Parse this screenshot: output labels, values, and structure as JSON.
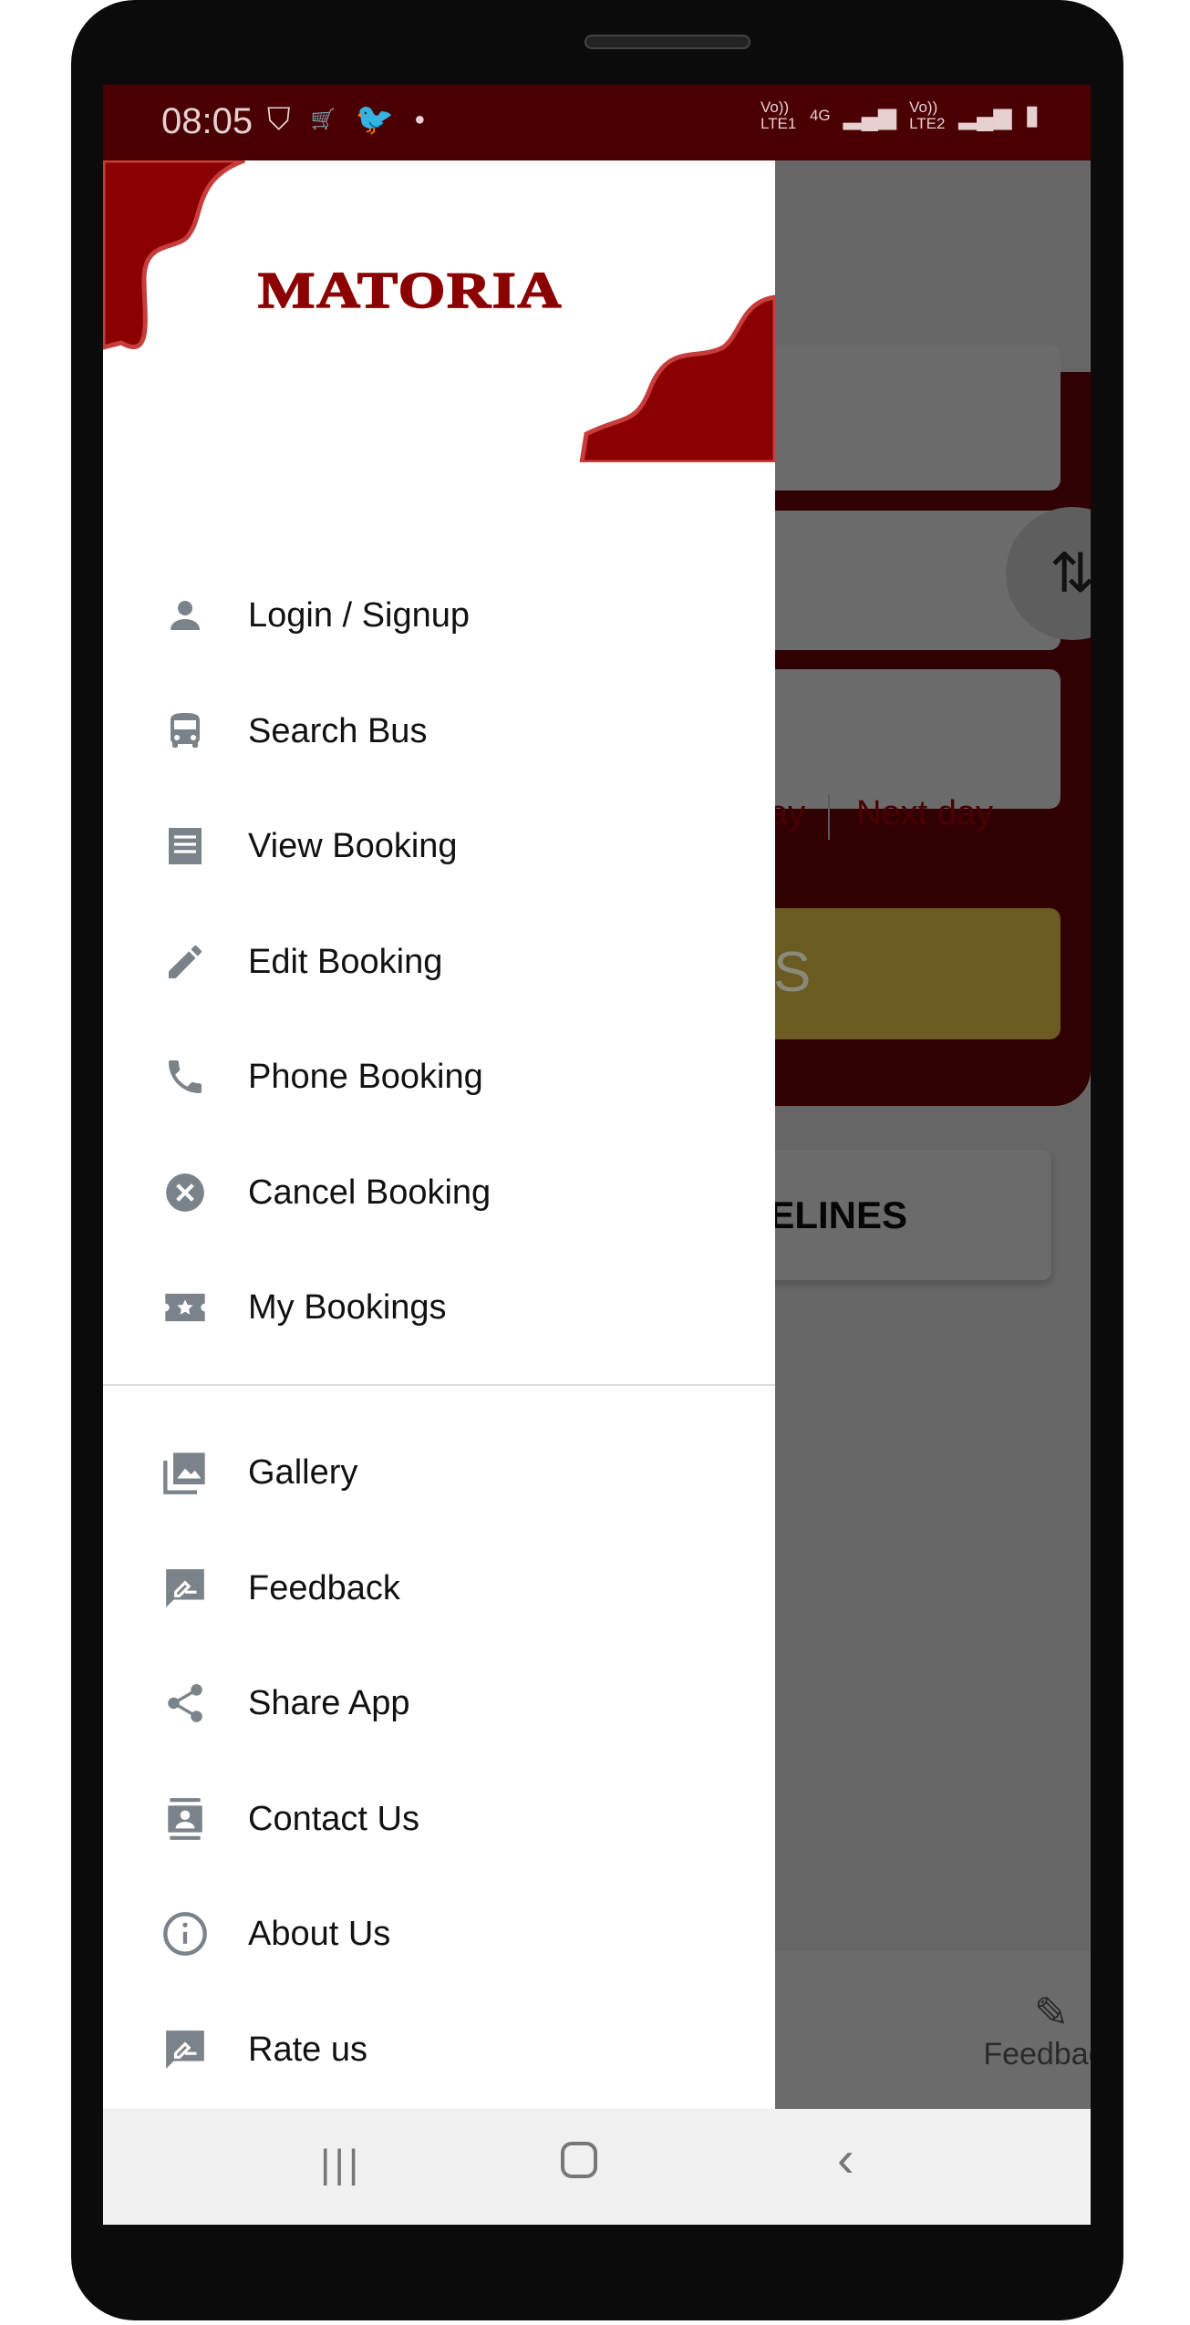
{
  "status_bar": {
    "time": "08:05",
    "left_icons": [
      "shield-check-icon",
      "amazon-cart-icon",
      "twitter-icon",
      "dot-icon"
    ],
    "sim1": "Vo)) LTE1",
    "network": "4G",
    "sim2": "Vo)) LTE2",
    "battery": "charging"
  },
  "drawer": {
    "logo": "MATORIA",
    "items": [
      {
        "label": "Login / Signup",
        "icon": "person-icon"
      },
      {
        "label": "Search Bus",
        "icon": "bus-icon"
      },
      {
        "label": "View Booking",
        "icon": "receipt-icon"
      },
      {
        "label": "Edit Booking",
        "icon": "pencil-icon"
      },
      {
        "label": "Phone Booking",
        "icon": "phone-icon"
      },
      {
        "label": "Cancel Booking",
        "icon": "cancel-icon"
      },
      {
        "label": "My Bookings",
        "icon": "ticket-star-icon"
      }
    ],
    "secondary_items": [
      {
        "label": "Gallery",
        "icon": "gallery-icon"
      },
      {
        "label": "Feedback",
        "icon": "feedback-icon"
      },
      {
        "label": "Share App",
        "icon": "share-icon"
      },
      {
        "label": "Contact Us",
        "icon": "contact-icon"
      },
      {
        "label": "About Us",
        "icon": "info-icon"
      },
      {
        "label": "Rate us",
        "icon": "rate-icon"
      }
    ]
  },
  "background": {
    "today_partial": "ay",
    "next_day": "Next day",
    "search_partial": "S",
    "guidelines_partial": "DELINES",
    "bottom_nav_feedback": "Feedback",
    "colors": {
      "brand": "#8b0000",
      "status_bar": "#4a0003"
    }
  }
}
